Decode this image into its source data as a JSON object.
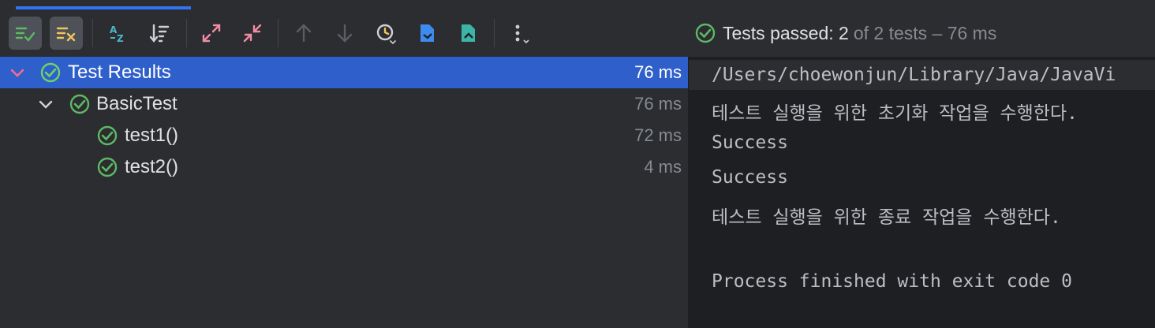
{
  "toolbar": {
    "buttons": [
      {
        "name": "show-passed-icon"
      },
      {
        "name": "show-ignored-icon"
      },
      {
        "name": "sort-alphabetically-icon"
      },
      {
        "name": "sort-by-duration-icon"
      },
      {
        "name": "expand-all-icon"
      },
      {
        "name": "collapse-all-icon"
      },
      {
        "name": "previous-failed-icon"
      },
      {
        "name": "next-failed-icon"
      },
      {
        "name": "test-history-icon"
      },
      {
        "name": "import-tests-icon"
      },
      {
        "name": "export-tests-icon"
      },
      {
        "name": "more-options-icon"
      }
    ]
  },
  "status": {
    "passed": "Tests passed: 2",
    "rest": "of 2 tests – 76 ms"
  },
  "tree": {
    "root": {
      "label": "Test Results",
      "time": "76 ms"
    },
    "suite": {
      "label": "BasicTest",
      "time": "76 ms"
    },
    "tests": [
      {
        "label": "test1()",
        "time": "72 ms"
      },
      {
        "label": "test2()",
        "time": "4 ms"
      }
    ]
  },
  "console": {
    "lines": [
      "/Users/choewonjun/Library/Java/JavaVi",
      "테스트 실행을 위한 초기화 작업을 수행한다.",
      "Success",
      "Success",
      "테스트 실행을 위한 종료 작업을 수행한다.",
      "",
      "Process finished with exit code 0"
    ]
  },
  "colors": {
    "accent": "#3574f0",
    "selection": "#2e5fca",
    "success": "#5fb865",
    "background": "#2b2d30",
    "console_bg": "#1e1f22"
  }
}
